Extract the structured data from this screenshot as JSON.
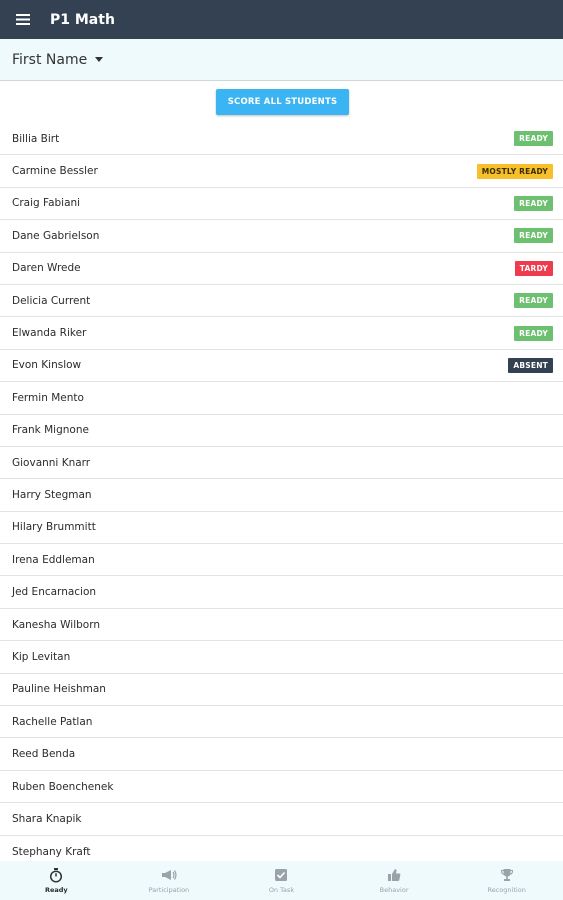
{
  "header": {
    "title": "P1 Math",
    "menu_icon": "hamburger-menu-icon"
  },
  "sort": {
    "label": "First Name",
    "icon": "caret-down-icon"
  },
  "actions": {
    "score_all_label": "SCORE ALL STUDENTS"
  },
  "colors": {
    "header_bg": "#344152",
    "accent": "#3ab4f2",
    "ready": "#6cc070",
    "mostly_ready": "#f7c02b",
    "tardy": "#ef3b4e",
    "absent": "#344152"
  },
  "students": [
    {
      "name": "Billia Birt",
      "status": "READY"
    },
    {
      "name": "Carmine Bessler",
      "status": "MOSTLY READY"
    },
    {
      "name": "Craig Fabiani",
      "status": "READY"
    },
    {
      "name": "Dane Gabrielson",
      "status": "READY"
    },
    {
      "name": "Daren Wrede",
      "status": "TARDY"
    },
    {
      "name": "Delicia Current",
      "status": "READY"
    },
    {
      "name": "Elwanda Riker",
      "status": "READY"
    },
    {
      "name": "Evon Kinslow",
      "status": "ABSENT"
    },
    {
      "name": "Fermin Mento",
      "status": ""
    },
    {
      "name": "Frank Mignone",
      "status": ""
    },
    {
      "name": "Giovanni Knarr",
      "status": ""
    },
    {
      "name": "Harry Stegman",
      "status": ""
    },
    {
      "name": "Hilary Brummitt",
      "status": ""
    },
    {
      "name": "Irena Eddleman",
      "status": ""
    },
    {
      "name": "Jed Encarnacion",
      "status": ""
    },
    {
      "name": "Kanesha Wilborn",
      "status": ""
    },
    {
      "name": "Kip Levitan",
      "status": ""
    },
    {
      "name": "Pauline Heishman",
      "status": ""
    },
    {
      "name": "Rachelle Patlan",
      "status": ""
    },
    {
      "name": "Reed Benda",
      "status": ""
    },
    {
      "name": "Ruben Boenchenek",
      "status": ""
    },
    {
      "name": "Shara Knapik",
      "status": ""
    },
    {
      "name": "Stephany Kraft",
      "status": ""
    }
  ],
  "bottom_nav": [
    {
      "label": "Ready",
      "icon": "stopwatch-icon",
      "active": true
    },
    {
      "label": "Participation",
      "icon": "megaphone-icon",
      "active": false
    },
    {
      "label": "On Task",
      "icon": "checkbox-icon",
      "active": false
    },
    {
      "label": "Behavior",
      "icon": "thumbs-up-icon",
      "active": false
    },
    {
      "label": "Recognition",
      "icon": "trophy-icon",
      "active": false
    }
  ]
}
